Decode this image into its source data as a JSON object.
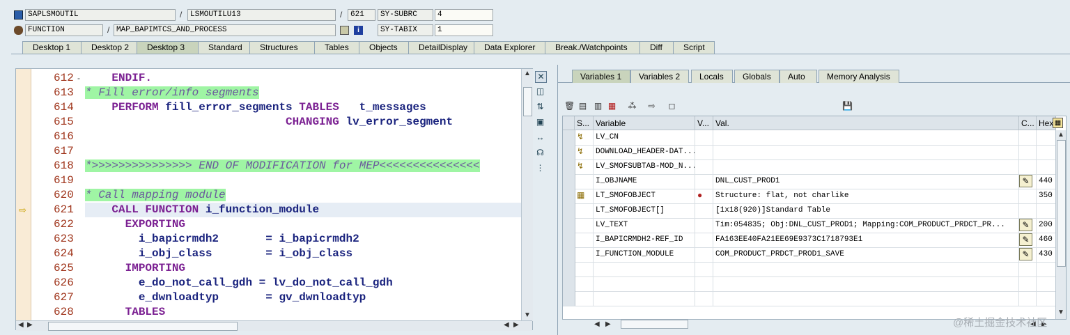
{
  "header": {
    "program": "SAPLSMOUTIL",
    "include": "LSMOUTILU13",
    "line": "621",
    "event_type": "FUNCTION",
    "event": "MAP_BAPIMTCS_AND_PROCESS",
    "sysfields": [
      {
        "name": "SY-SUBRC",
        "value": "4"
      },
      {
        "name": "SY-TABIX",
        "value": "1"
      }
    ]
  },
  "desktop_tabs": [
    "Desktop 1",
    "Desktop 2",
    "Desktop 3",
    "Standard",
    "Structures",
    "Tables",
    "Objects",
    "DetailDisplay",
    "Data Explorer",
    "Break./Watchpoints",
    "Diff",
    "Script"
  ],
  "code": {
    "line_numbers": [
      "612",
      "613",
      "614",
      "615",
      "616",
      "617",
      "618",
      "619",
      "620",
      "621",
      "622",
      "623",
      "624",
      "625",
      "626",
      "627",
      "628"
    ],
    "fold_marker": "-",
    "lines": [
      [
        {
          "t": "    "
        },
        {
          "t": "ENDIF.",
          "k": "kw"
        }
      ],
      [
        {
          "t": "* Fill error/info segments",
          "k": "cm"
        }
      ],
      [
        {
          "t": "    "
        },
        {
          "t": "PERFORM",
          "k": "kw"
        },
        {
          "t": " fill_error_segments "
        },
        {
          "t": "TABLES",
          "k": "kw"
        },
        {
          "t": "   t_messages"
        }
      ],
      [
        {
          "t": "                              "
        },
        {
          "t": "CHANGING",
          "k": "kw"
        },
        {
          "t": " lv_error_segment"
        }
      ],
      [],
      [],
      [
        {
          "t": "*>>>>>>>>>>>>>>> END OF MODIFICATION for MEP<<<<<<<<<<<<<<<",
          "k": "cm"
        }
      ],
      [],
      [
        {
          "t": "* Call mapping module",
          "k": "cm"
        }
      ],
      [
        {
          "t": "    "
        },
        {
          "t": "CALL FUNCTION",
          "k": "kw"
        },
        {
          "t": " i_function_module"
        }
      ],
      [
        {
          "t": "      "
        },
        {
          "t": "EXPORTING",
          "k": "kw"
        }
      ],
      [
        {
          "t": "        i_bapicrmdh2       = i_bapicrmdh2"
        }
      ],
      [
        {
          "t": "        i_obj_class        = i_obj_class"
        }
      ],
      [
        {
          "t": "      "
        },
        {
          "t": "IMPORTING",
          "k": "kw"
        }
      ],
      [
        {
          "t": "        e_do_not_call_gdh = lv_do_not_call_gdh"
        }
      ],
      [
        {
          "t": "        e_dwnloadtyp       = gv_dwnloadtyp"
        }
      ],
      [
        {
          "t": "      "
        },
        {
          "t": "TABLES",
          "k": "kw"
        }
      ]
    ],
    "current_line_index": 9,
    "current_marker": "⇨"
  },
  "side_toolbar": [
    "close-icon",
    "new-window-icon",
    "swap-icon",
    "maximize-icon",
    "resize-icon",
    "headset-icon",
    "tree-icon"
  ],
  "var_tabs": [
    "Variables 1",
    "Variables 2",
    "Locals",
    "Globals",
    "Auto",
    "Memory Analysis"
  ],
  "var_toolbar": [
    "delete-icon",
    "import-icon",
    "export-icon",
    "print-icon",
    "tree-icon",
    "arrow-icon",
    "new-icon",
    "save-icon"
  ],
  "grid": {
    "headers": [
      "S...",
      "Variable",
      "V...",
      "Val.",
      "C...",
      "Hex"
    ],
    "rows": [
      {
        "icon": "↯",
        "variable": "LV_CN",
        "v": "",
        "value": "",
        "edit": false,
        "hex": ""
      },
      {
        "icon": "↯",
        "variable": "DOWNLOAD_HEADER-DAT...",
        "v": "",
        "value": "",
        "edit": false,
        "hex": ""
      },
      {
        "icon": "↯",
        "variable": "LV_SMOFSUBTAB-MOD_N...",
        "v": "",
        "value": "",
        "edit": false,
        "hex": ""
      },
      {
        "icon": "",
        "variable": "I_OBJNAME",
        "v": "",
        "value": "DNL_CUST_PROD1",
        "edit": true,
        "hex": "440"
      },
      {
        "icon": "▦",
        "variable": "LT_SMOFOBJECT",
        "v": "●",
        "value": "Structure: flat, not charlike",
        "edit": false,
        "hex": "350"
      },
      {
        "icon": "",
        "variable": "LT_SMOFOBJECT[]",
        "v": "",
        "value": "[1x18(920)]Standard Table",
        "edit": false,
        "hex": ""
      },
      {
        "icon": "",
        "variable": "LV_TEXT",
        "v": "",
        "value": " Tim:054835; Obj:DNL_CUST_PROD1; Mapping:COM_PRODUCT_PRDCT_PR...",
        "edit": true,
        "hex": "200"
      },
      {
        "icon": "",
        "variable": "I_BAPICRMDH2-REF_ID",
        "v": "",
        "value": "FA163EE40FA21EE69E9373C1718793E1",
        "edit": true,
        "hex": "460"
      },
      {
        "icon": "",
        "variable": "I_FUNCTION_MODULE",
        "v": "",
        "value": "COM_PRODUCT_PRDCT_PROD1_SAVE",
        "edit": true,
        "hex": "430"
      },
      {
        "icon": "",
        "variable": "",
        "v": "",
        "value": "",
        "edit": false,
        "hex": ""
      },
      {
        "icon": "",
        "variable": "",
        "v": "",
        "value": "",
        "edit": false,
        "hex": ""
      },
      {
        "icon": "",
        "variable": "",
        "v": "",
        "value": "",
        "edit": false,
        "hex": ""
      }
    ]
  },
  "watermark": "@稀土掘金技术社区"
}
